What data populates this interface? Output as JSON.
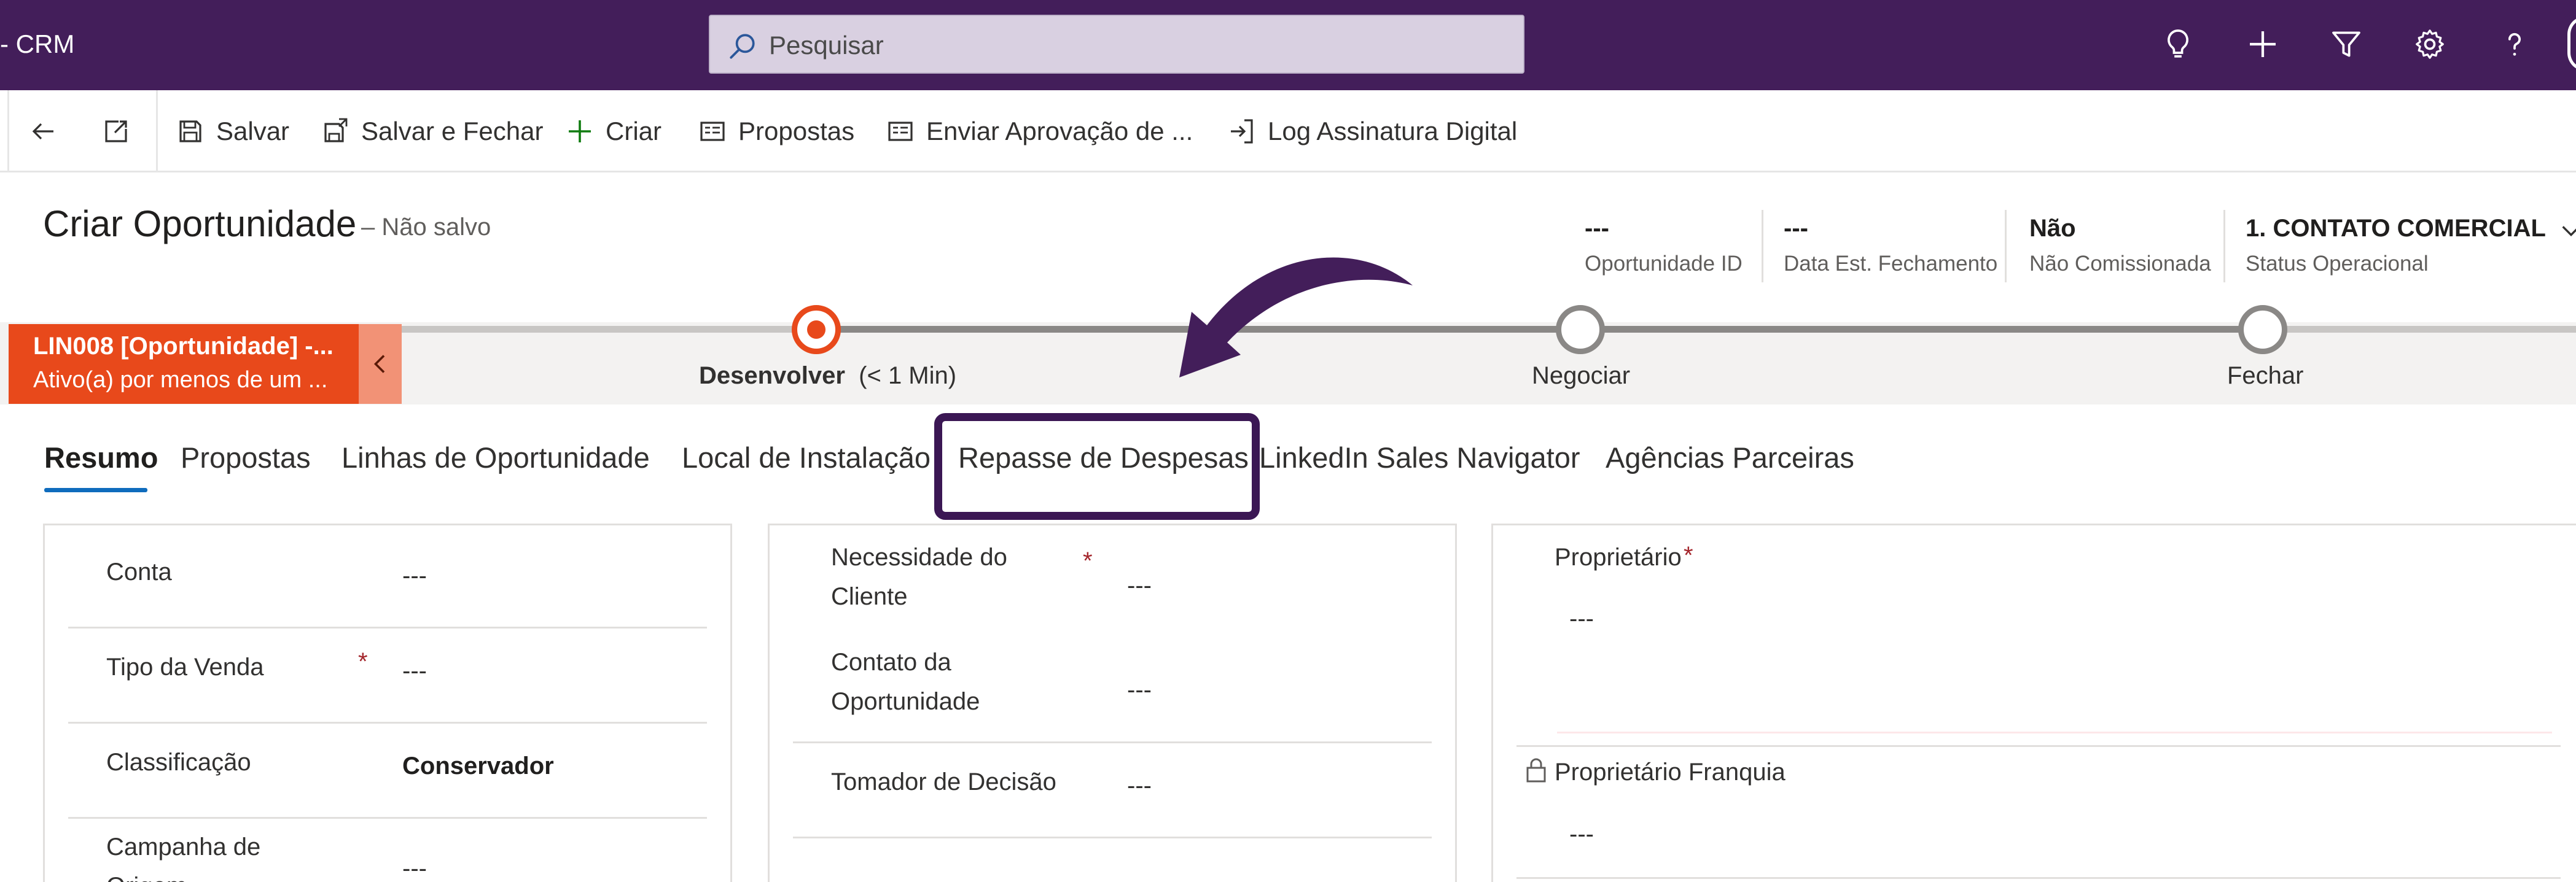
{
  "app": {
    "title": "- CRM"
  },
  "search": {
    "placeholder": "Pesquisar"
  },
  "topbar_icons": [
    "lightbulb-icon",
    "plus-icon",
    "filter-icon",
    "gear-icon",
    "help-icon"
  ],
  "commandbar": {
    "save": "Salvar",
    "save_close": "Salvar e Fechar",
    "create": "Criar",
    "proposals": "Propostas",
    "send_approval": "Enviar Aprovação de ...",
    "signature_log": "Log Assinatura Digital"
  },
  "form": {
    "title": "Criar Oportunidade",
    "status": "– Não salvo"
  },
  "header_fields": [
    {
      "value": "---",
      "label": "Oportunidade ID"
    },
    {
      "value": "---",
      "label": "Data Est. Fechamento"
    },
    {
      "value": "Não",
      "label": "Não Comissionada"
    },
    {
      "value": "1. CONTATO COMERCIAL",
      "label": "Status Operacional"
    }
  ],
  "bpf": {
    "flag_title": "LIN008 [Oportunidade] -...",
    "flag_subtitle": "Ativo(a) por menos de um ...",
    "stages": [
      {
        "name": "Desenvolver",
        "duration": "(< 1 Min)",
        "state": "active"
      },
      {
        "name": "Negociar",
        "state": "pending"
      },
      {
        "name": "Fechar",
        "state": "pending"
      }
    ]
  },
  "tabs": [
    "Resumo",
    "Propostas",
    "Linhas de Oportunidade",
    "Local de Instalação",
    "Repasse de Despesas",
    "LinkedIn Sales Navigator",
    "Agências Parceiras"
  ],
  "section1": {
    "fields": [
      {
        "label": "Conta",
        "value": "---",
        "required": false
      },
      {
        "label": "Tipo da Venda",
        "value": "---",
        "required": true
      },
      {
        "label": "Classificação",
        "value": "Conservador",
        "required": false
      },
      {
        "label": "Campanha de",
        "label2": "Origem",
        "value": "---",
        "required": false
      }
    ]
  },
  "section2": {
    "fields": [
      {
        "label": "Necessidade do",
        "label2": "Cliente",
        "value": "---",
        "required": true
      },
      {
        "label": "Contato da",
        "label2": "Oportunidade",
        "value": "---",
        "required": false
      },
      {
        "label": "Tomador de Decisão",
        "value": "---",
        "required": false
      }
    ]
  },
  "section3": {
    "fields": [
      {
        "label": "Proprietário",
        "value": "---",
        "required": true
      },
      {
        "label": "Proprietário Franquia",
        "value": "---",
        "locked": true
      }
    ]
  },
  "colors": {
    "topbar": "#431e5a",
    "bpf_flag": "#e8491b",
    "active_tab": "#0f6cbd",
    "highlight_box": "#3b1754",
    "required": "#a4262c"
  }
}
